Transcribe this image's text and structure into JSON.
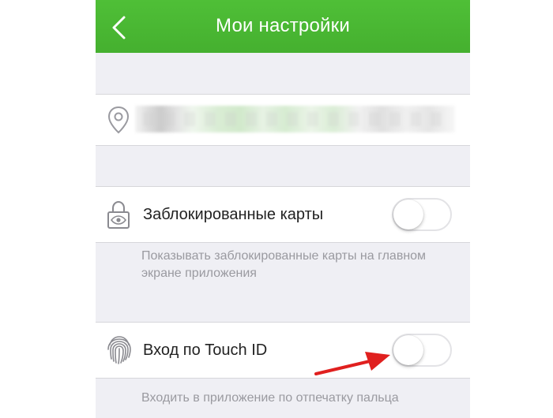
{
  "nav": {
    "title": "Мои настройки",
    "back_icon": "chevron-left-icon",
    "color": "#4cb933"
  },
  "address": {
    "icon": "location-pin-icon",
    "value_redacted": true
  },
  "settings": [
    {
      "label": "Заблокированные карты",
      "icon": "lock-eye-icon",
      "enabled": false,
      "description": "Показывать заблокированные карты на главном экране приложения"
    },
    {
      "label": "Вход по Touch ID",
      "icon": "fingerprint-icon",
      "enabled": false,
      "description": "Входить в приложение по отпечатку пальца"
    }
  ],
  "annotation": {
    "icon": "red-arrow-icon",
    "color": "#e0201f"
  }
}
